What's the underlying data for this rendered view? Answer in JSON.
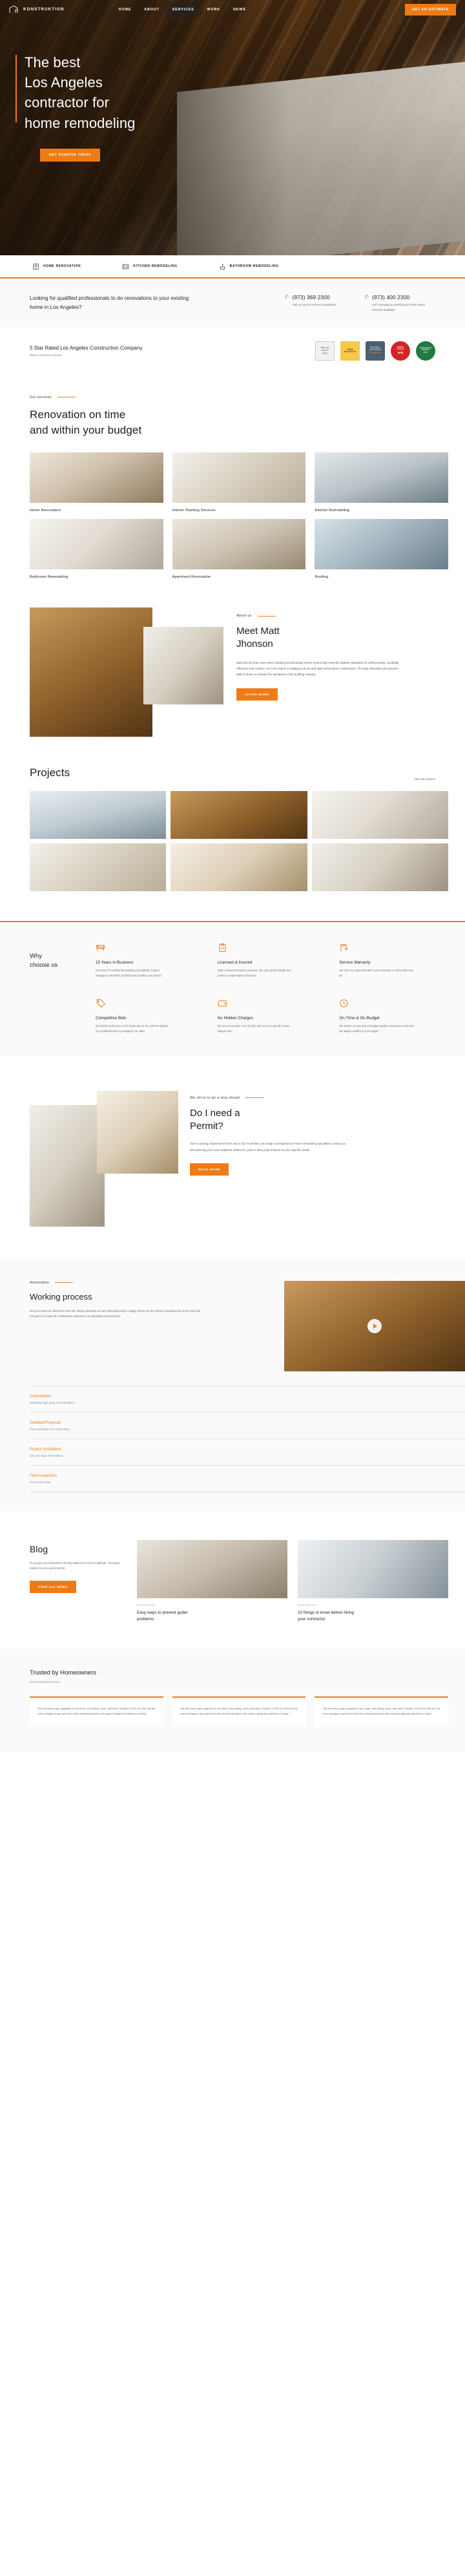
{
  "header": {
    "logo_text": "KONSTRUKTION",
    "nav": [
      {
        "label": "HOME",
        "active": false
      },
      {
        "label": "ABOUT",
        "active": false
      },
      {
        "label": "SERVICES",
        "active": true
      },
      {
        "label": "WORK",
        "active": false
      },
      {
        "label": "NEWS",
        "active": false
      }
    ],
    "cta_label": "GET AN ESTIMATE"
  },
  "hero": {
    "line1": "The best",
    "line2": "Los Angeles",
    "line3": "contractor for",
    "line4": "home remodeling",
    "button": "GET STARTED TODAY"
  },
  "icon_strip": [
    {
      "icon": "window-icon",
      "label": "HOME RENOVATION"
    },
    {
      "icon": "stove-icon",
      "label": "KITCHEN REMODELING"
    },
    {
      "icon": "shower-icon",
      "label": "BATHROOM REMODELING"
    }
  ],
  "cta_bar": {
    "question": "Looking for qualified professionals to do renovations to your existing home in Los Angeles?",
    "phones": [
      {
        "icon": "phone-icon",
        "number": "(973) 369 2300",
        "note": "Call us now for a free consultation"
      },
      {
        "icon": "phone-icon",
        "number": "(973) 400 2300",
        "note": "24/7 emergency plumbing or home repair services available"
      }
    ]
  },
  "reviews": {
    "title": "5 Star Rated Los Angeles Construction Company",
    "subtitle": "Read customers reviews",
    "badges": [
      {
        "name": "houzz-2020-badge",
        "l1": "Best of",
        "l2": "houzz",
        "l3": "2020",
        "l4": "SERVICE"
      },
      {
        "name": "houzz-2021-badge",
        "l1": "",
        "l2": "2021",
        "l3": "Best of Houzz",
        "l4": "Service"
      },
      {
        "name": "homeadvisor-top-rated-badge",
        "l1": "HomeAdvisor",
        "l2": "TOP RATED",
        "l3": "★★★★★",
        "l4": ""
      },
      {
        "name": "yelp-people-love-us-badge",
        "l1": "PEOPLE",
        "l2": "LOVE US",
        "l3": "yelp",
        "l4": ""
      },
      {
        "name": "angies-list-super-service-badge",
        "l1": "Angie's list",
        "l2": "SUPER SERVICE",
        "l3": "AWARD",
        "l4": "2020"
      }
    ]
  },
  "services": {
    "eyebrow": "Our services",
    "heading_l1": "Renovation on time",
    "heading_l2": "and within your budget",
    "cards": [
      {
        "label": "Home Renovation",
        "ph": "ph1"
      },
      {
        "label": "Interior Painting Services",
        "ph": "ph2"
      },
      {
        "label": "Kitchen Remodeling",
        "ph": "ph3"
      },
      {
        "label": "Bathroom Remodeling",
        "ph": "ph4"
      },
      {
        "label": "Apartment Renovation",
        "ph": "ph5"
      },
      {
        "label": "Roofing",
        "ph": "ph6"
      }
    ]
  },
  "about": {
    "eyebrow": "About us",
    "heading_l1": "Meet Matt",
    "heading_l2": "Jhonson",
    "paragraph": "Matt and his team have been building architecturally driven homes that meet the highest standards of craftsmanship, durability, efficiency and comfort. He is an expert in building science and high performance construction. Through education and practice, Matt is driven to elevate the standards of the building industry.",
    "button": "LEARN MORE"
  },
  "projects": {
    "title": "Projects",
    "link": "View all projects"
  },
  "why": {
    "heading_l1": "Why",
    "heading_l2": "choose us",
    "features": [
      {
        "icon": "barrier-icon",
        "title": "15 Years in Business",
        "desc": "Our team of Certified Remodeling Consultants, Project Managers and trades professionals handles your project."
      },
      {
        "icon": "clipboard-check-icon",
        "title": "Licensed & Insured",
        "desc": "Fully Licensed General Contractor. We carry all the liability and workers compensation insurance."
      },
      {
        "icon": "crane-icon",
        "title": "Service Warranty",
        "desc": "We have an unprecedented 1-year warranty on all the labor we do."
      },
      {
        "icon": "price-tag-icon",
        "title": "Competitive Bids",
        "desc": "We bid the work price on the exact job we do, with the highest for neighborhoods or prestigious car sales."
      },
      {
        "icon": "wallet-icon",
        "title": "No Hidden Charges",
        "desc": "We never buy extra 'cost' the job, just to let you get all it takes charges bid."
      },
      {
        "icon": "clock-icon",
        "title": "On-Time & On-Budget",
        "desc": "We deliver on time and on-budget quality construction work and we always mindful of your budget."
      }
    ]
  },
  "permit": {
    "eyebrow": "We strive to be a step ahead",
    "heading_l1": "Do I need a",
    "heading_l2": "Permit?",
    "paragraph": "You're causing requirements from city to city for permits, we assign a designated in-home remodeling specialist to assist you with planning your room additions, bathroom, pool or deck project based on your specific needs.",
    "button": "READ MORE"
  },
  "process": {
    "eyebrow": "Automation",
    "title": "Working process",
    "paragraph": "Our processes are tailored to meet the unique demands of each individual project. Happy clients are the shared rewarding part of the work and our goal is to make the construction experience as enjoyable as the product.",
    "steps": [
      {
        "title": "Consultation",
        "desc": "Redefining high-goals and expeditions"
      },
      {
        "title": "Detailed Proposal",
        "desc": "Project Estimate, the Added Value"
      },
      {
        "title": "Project Installation",
        "desc": "safe and magic Renovations"
      },
      {
        "title": "Final Inspection",
        "desc": "Final Touch Value"
      }
    ]
  },
  "blog": {
    "title": "Blog",
    "paragraph": "Our people are dedicated to finding solutions to every challenge. That spirit makes for some great stories.",
    "button": "VIEW ALL NEWS",
    "posts": [
      {
        "category": "RENOVATION",
        "title_l1": "Easy ways to prevent gutter",
        "title_l2": "problems",
        "ph": "ph11"
      },
      {
        "category": "RENOVATION",
        "title_l1": "10 things to know before hiring",
        "title_l2": "your contractor",
        "ph": "ph12"
      }
    ]
  },
  "testimonials": {
    "title": "Trusted by Homeowners",
    "subtitle": "Read customers reviews",
    "cards": [
      {
        "text": "\"We did many major upgrades to our home, new siding, doors, and deck. Despite COVID-19, Nick and his crew managed to get work done with minimal disruption with superb quality and attention to detail.\""
      },
      {
        "text": "\"We did many major upgrades to our home, new siding, doors, and deck. Despite COVID-19, Nick and his crew managed to get work done with minimal disruption with superb quality and attention to detail.\""
      },
      {
        "text": "\"We did many major upgrades to our home, new siding, doors, and deck. Despite COVID-19, Nick and his crew managed to get work done with minimal disruption with superb quality and attention to detail.\""
      }
    ]
  }
}
